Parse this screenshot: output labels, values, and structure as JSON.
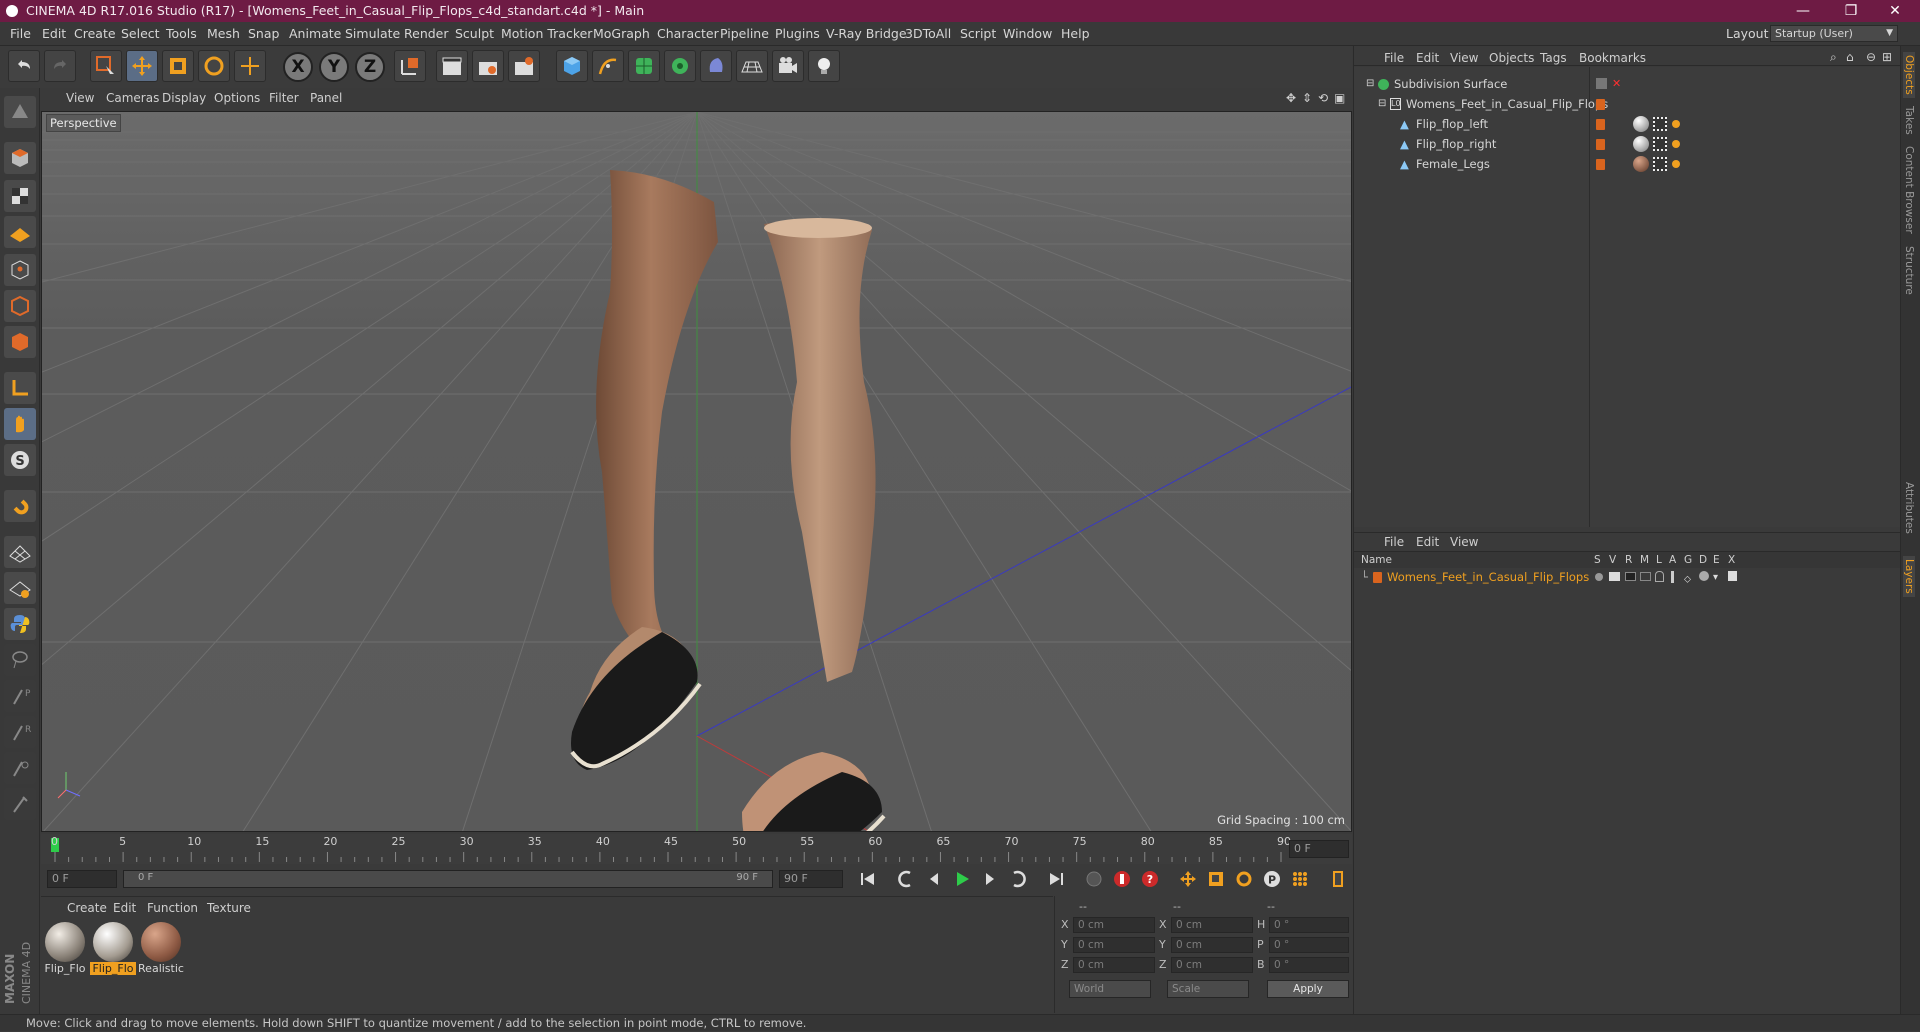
{
  "window": {
    "title": "CINEMA 4D R17.016 Studio (R17) - [Womens_Feet_in_Casual_Flip_Flops_c4d_standart.c4d *] - Main",
    "minimize": "—",
    "restore": "❐",
    "close": "✕"
  },
  "menubar": {
    "items": [
      "File",
      "Edit",
      "Create",
      "Select",
      "Tools",
      "Mesh",
      "Snap",
      "Animate",
      "Simulate",
      "Render",
      "Sculpt",
      "Motion Tracker",
      "MoGraph",
      "Character",
      "Pipeline",
      "Plugins",
      "V-Ray Bridge",
      "3DToAll",
      "Script",
      "Window",
      "Help"
    ],
    "layout_label": "Layout:",
    "layout_value": "Startup (User)"
  },
  "toolbar": {
    "axis_x": "X",
    "axis_y": "Y",
    "axis_z": "Z"
  },
  "viewport": {
    "menu": [
      "View",
      "Cameras",
      "Display",
      "Options",
      "Filter",
      "Panel"
    ],
    "camera_label": "Perspective",
    "grid_spacing": "Grid Spacing : 100 cm"
  },
  "timeline": {
    "ticks": [
      "0",
      "5",
      "10",
      "15",
      "20",
      "25",
      "30",
      "35",
      "40",
      "45",
      "50",
      "55",
      "60",
      "65",
      "70",
      "75",
      "80",
      "85",
      "90"
    ],
    "current_frame": "0 F"
  },
  "transport": {
    "start_field": "0 F",
    "range_start": "0 F",
    "range_end": "90 F",
    "end_field": "90 F"
  },
  "materials": {
    "menu": [
      "Create",
      "Edit",
      "Function",
      "Texture"
    ],
    "items": [
      {
        "label": "Flip_Flo",
        "selected": false
      },
      {
        "label": "Flip_Flo",
        "selected": true
      },
      {
        "label": "Realistic",
        "selected": false
      }
    ]
  },
  "coordinates": {
    "header_a": "--",
    "header_b": "--",
    "header_c": "--",
    "rows": [
      {
        "a": "X",
        "av": "0 cm",
        "b": "X",
        "bv": "0 cm",
        "c": "H",
        "cv": "0 °"
      },
      {
        "a": "Y",
        "av": "0 cm",
        "b": "Y",
        "bv": "0 cm",
        "c": "P",
        "cv": "0 °"
      },
      {
        "a": "Z",
        "av": "0 cm",
        "b": "Z",
        "bv": "0 cm",
        "c": "B",
        "cv": "0 °"
      }
    ],
    "world": "World",
    "scale": "Scale",
    "apply": "Apply"
  },
  "objects": {
    "menu": [
      "File",
      "Edit",
      "View",
      "Objects",
      "Tags",
      "Bookmarks"
    ],
    "tree": [
      {
        "name": "Subdivision Surface",
        "level": 0
      },
      {
        "name": "Womens_Feet_in_Casual_Flip_Flops",
        "level": 1
      },
      {
        "name": "Flip_flop_left",
        "level": 2
      },
      {
        "name": "Flip_flop_right",
        "level": 2
      },
      {
        "name": "Female_Legs",
        "level": 2
      }
    ]
  },
  "layers": {
    "menu": [
      "File",
      "Edit",
      "View"
    ],
    "columns": [
      "Name",
      "S",
      "V",
      "R",
      "M",
      "L",
      "A",
      "G",
      "D",
      "E",
      "X"
    ],
    "row_name": "Womens_Feet_in_Casual_Flip_Flops"
  },
  "side_tabs": [
    "Objects",
    "Takes",
    "Content Browser",
    "Structure",
    "Attributes",
    "Layers"
  ],
  "status": "Move: Click and drag to move elements. Hold down SHIFT to quantize movement / add to the selection in point mode, CTRL to remove.",
  "brand": "MAXON CINEMA 4D"
}
